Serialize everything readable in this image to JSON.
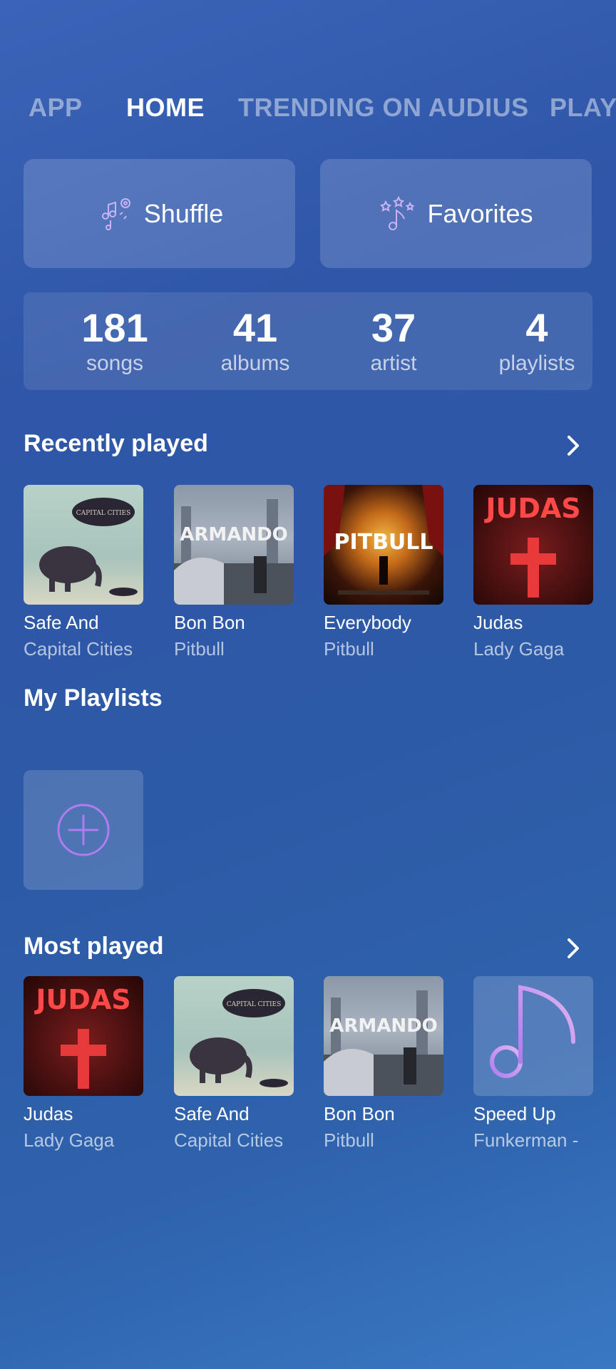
{
  "tabs": [
    {
      "label": "APP"
    },
    {
      "label": "HOME"
    },
    {
      "label": "TRENDING ON AUDIUS"
    },
    {
      "label": "PLAY"
    }
  ],
  "quick_actions": {
    "shuffle_label": "Shuffle",
    "favorites_label": "Favorites"
  },
  "stats": [
    {
      "value": "181",
      "label": "songs"
    },
    {
      "value": "41",
      "label": "albums"
    },
    {
      "value": "37",
      "label": "artist"
    },
    {
      "value": "4",
      "label": "playlists"
    }
  ],
  "recently_played": {
    "title": "Recently played",
    "items": [
      {
        "title": "Safe And",
        "artist": "Capital Cities",
        "art_text": "CAPITAL CITIES"
      },
      {
        "title": "Bon Bon",
        "artist": "Pitbull",
        "art_text": "ARMANDO"
      },
      {
        "title": "Everybody",
        "artist": "Pitbull",
        "art_text": "PITBULL"
      },
      {
        "title": "Judas",
        "artist": "Lady Gaga",
        "art_text": "JUDAS"
      }
    ]
  },
  "my_playlists": {
    "title": "My Playlists"
  },
  "most_played": {
    "title": "Most played",
    "items": [
      {
        "title": "Judas",
        "artist": "Lady Gaga",
        "art_text": "JUDAS"
      },
      {
        "title": "Safe And",
        "artist": "Capital Cities",
        "art_text": "CAPITAL CITIES"
      },
      {
        "title": "Bon Bon",
        "artist": "Pitbull",
        "art_text": "ARMANDO"
      },
      {
        "title": "Speed Up",
        "artist": "Funkerman -"
      }
    ]
  },
  "colors": {
    "accent": "#b07cf0",
    "background_top": "#3b64b8",
    "background_bottom": "#3a78c4"
  }
}
